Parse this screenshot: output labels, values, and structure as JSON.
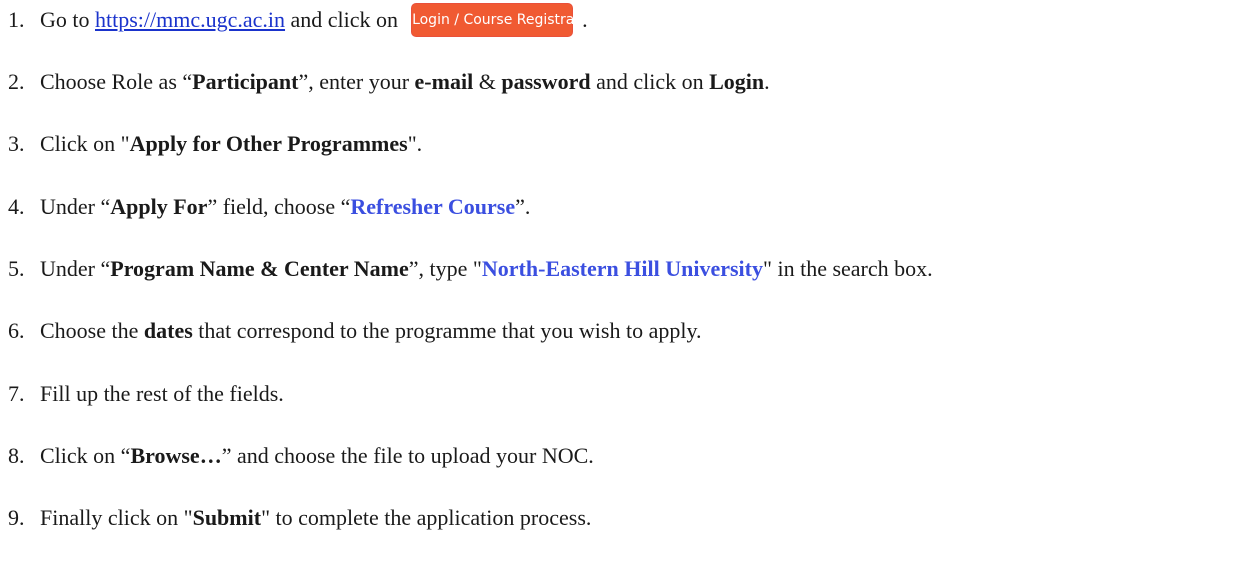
{
  "steps": [
    {
      "num": "1."
    },
    {
      "num": "2."
    },
    {
      "num": "3."
    },
    {
      "num": "4."
    },
    {
      "num": "5."
    },
    {
      "num": "6."
    },
    {
      "num": "7."
    },
    {
      "num": "8."
    },
    {
      "num": "9."
    }
  ],
  "s1": {
    "pre": "Go to ",
    "link": "https://mmc.ugc.ac.in",
    "mid": " and click on",
    "button": "Login / Course Registration",
    "end": "."
  },
  "s2": {
    "a": "Choose Role as “",
    "b": "Participant",
    "c": "”, enter your ",
    "d": "e-mail",
    "e": " & ",
    "f": "password",
    "g": " and click on ",
    "h": "Login",
    "i": "."
  },
  "s3": {
    "a": "Click on \"",
    "b": "Apply for Other Programmes",
    "c": "\"."
  },
  "s4": {
    "a": "Under “",
    "b": "Apply For",
    "c": "” field, choose “",
    "d": "Refresher Course",
    "e": "”."
  },
  "s5": {
    "a": "Under “",
    "b": "Program Name & Center Name",
    "c": "”, type \"",
    "d": "North-Eastern Hill University",
    "e": "\" in the search box."
  },
  "s6": {
    "a": "Choose the ",
    "b": "dates",
    "c": " that correspond to the programme that you wish to apply."
  },
  "s7": {
    "a": "Fill up the rest of the fields."
  },
  "s8": {
    "a": "Click on “",
    "b": "Browse…",
    "c": "” and choose the file to upload your NOC."
  },
  "s9": {
    "a": "Finally click on \"",
    "b": "Submit",
    "c": "\" to complete the application process."
  }
}
